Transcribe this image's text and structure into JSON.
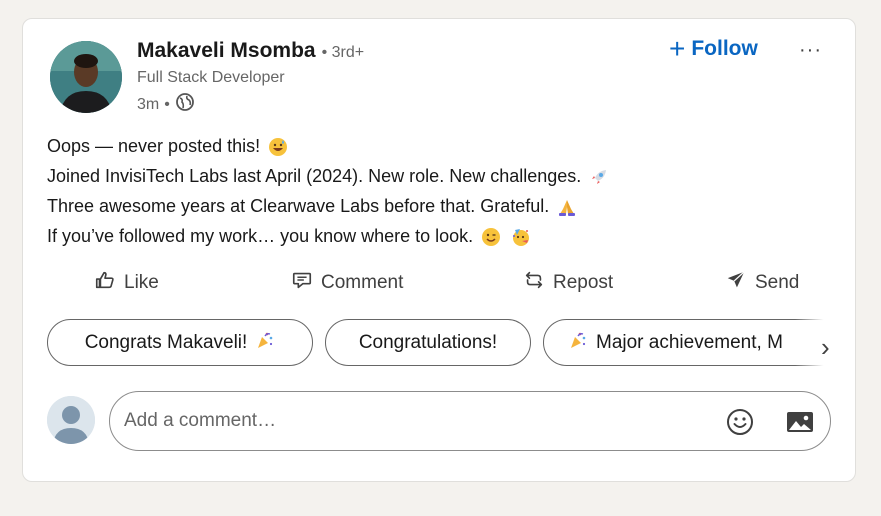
{
  "post": {
    "author": {
      "name": "Makaveli Msomba",
      "degree": "• 3rd+",
      "headline": "Full Stack Developer",
      "time": "3m",
      "visibility_icon": "globe-icon"
    },
    "follow_label": "Follow",
    "more_label": "···",
    "lines": [
      "Oops — never posted this!",
      "Joined InvisiTech Labs last April (2024). New role. New challenges.",
      "Three awesome years at Clearwave Labs before that. Grateful.",
      "If you’ve followed my work… you know where to look."
    ]
  },
  "actions": {
    "like": "Like",
    "comment": "Comment",
    "repost": "Repost",
    "send": "Send"
  },
  "suggestions": [
    "Congrats Makaveli!",
    "Congratulations!",
    "Major achievement, M"
  ],
  "comment": {
    "placeholder": "Add a comment…"
  },
  "colors": {
    "accent": "#0a66c2",
    "page_bg": "#f4f2ee"
  }
}
